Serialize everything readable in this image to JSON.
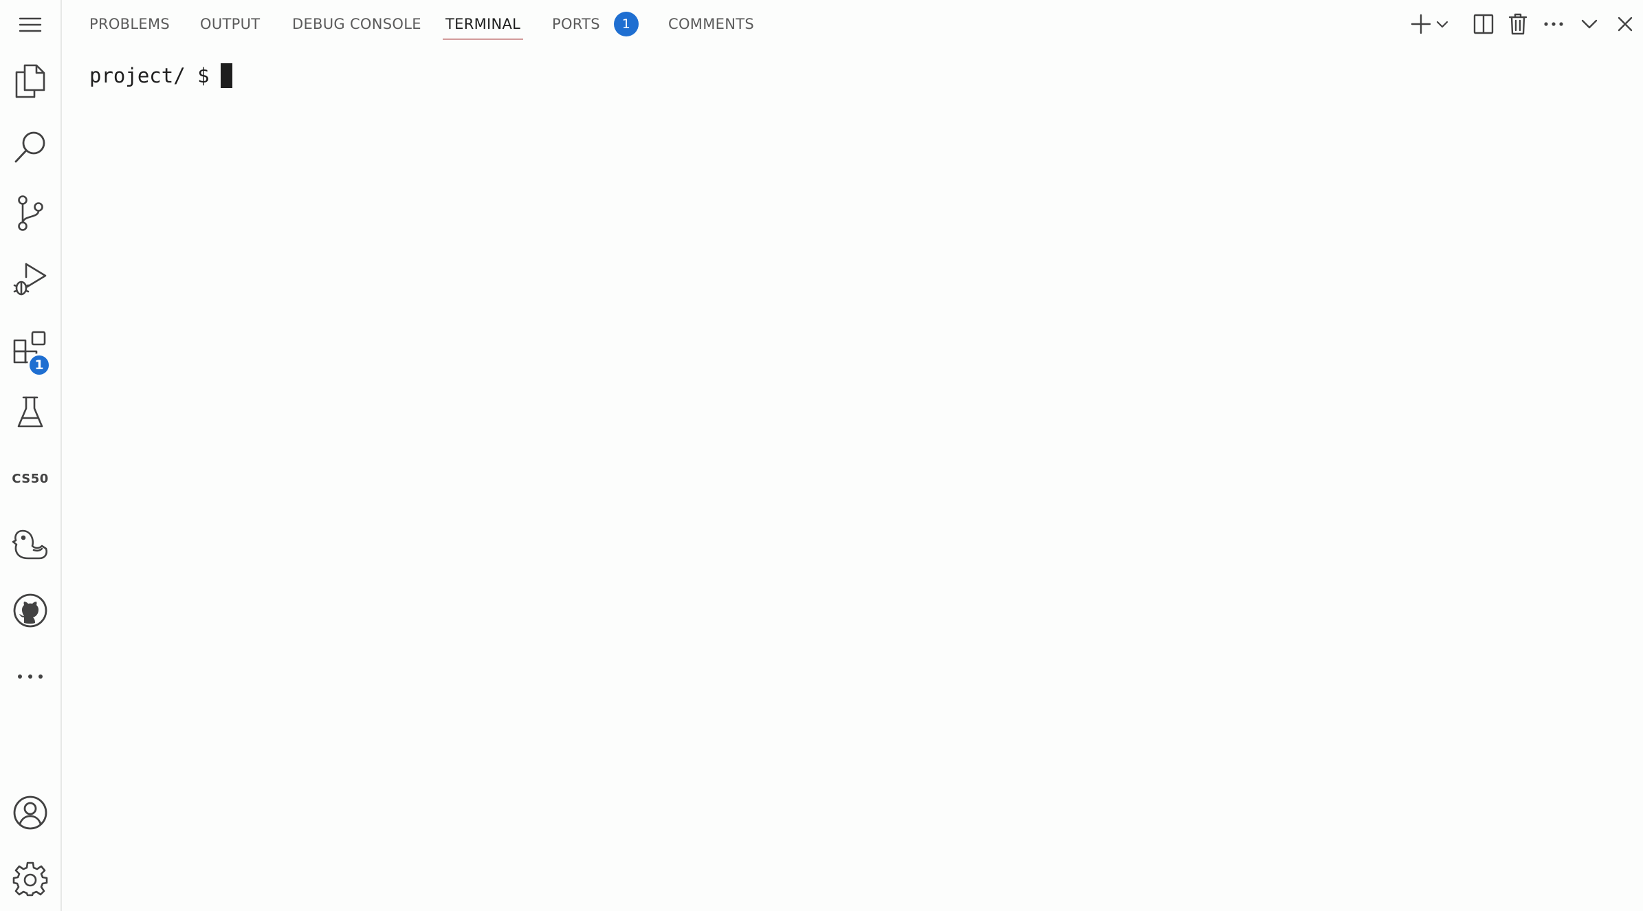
{
  "activity_bar": {
    "menu_icon": "hamburger-menu-icon",
    "items": [
      {
        "name": "explorer",
        "icon": "files-icon"
      },
      {
        "name": "search",
        "icon": "search-icon"
      },
      {
        "name": "source-control",
        "icon": "source-control-icon"
      },
      {
        "name": "run-debug",
        "icon": "run-debug-icon"
      },
      {
        "name": "extensions",
        "icon": "extensions-icon",
        "badge": "1"
      },
      {
        "name": "testing",
        "icon": "flask-icon"
      },
      {
        "name": "cs50",
        "label": "CS50"
      },
      {
        "name": "duck-debugger",
        "icon": "duck-icon"
      },
      {
        "name": "github",
        "icon": "github-icon"
      },
      {
        "name": "more",
        "icon": "ellipsis-icon"
      }
    ],
    "bottom": [
      {
        "name": "accounts",
        "icon": "account-icon"
      },
      {
        "name": "manage",
        "icon": "gear-icon"
      }
    ],
    "badge_color": "#1f6fd1"
  },
  "panel": {
    "tabs": [
      {
        "label": "PROBLEMS"
      },
      {
        "label": "OUTPUT"
      },
      {
        "label": "DEBUG CONSOLE"
      },
      {
        "label": "TERMINAL",
        "active": true
      },
      {
        "label": "PORTS",
        "badge": "1"
      },
      {
        "label": "COMMENTS"
      }
    ],
    "toolbar": [
      "plus-icon",
      "chevron-down-icon",
      "split-icon",
      "trash-icon",
      "ellipsis-icon",
      "chevron-down-icon",
      "close-icon"
    ]
  },
  "terminal": {
    "prompt": "project/ $"
  },
  "colors": {
    "background": "#fcfdfc",
    "active_tab_underline": "#d29a9a",
    "icon": "#424242"
  }
}
